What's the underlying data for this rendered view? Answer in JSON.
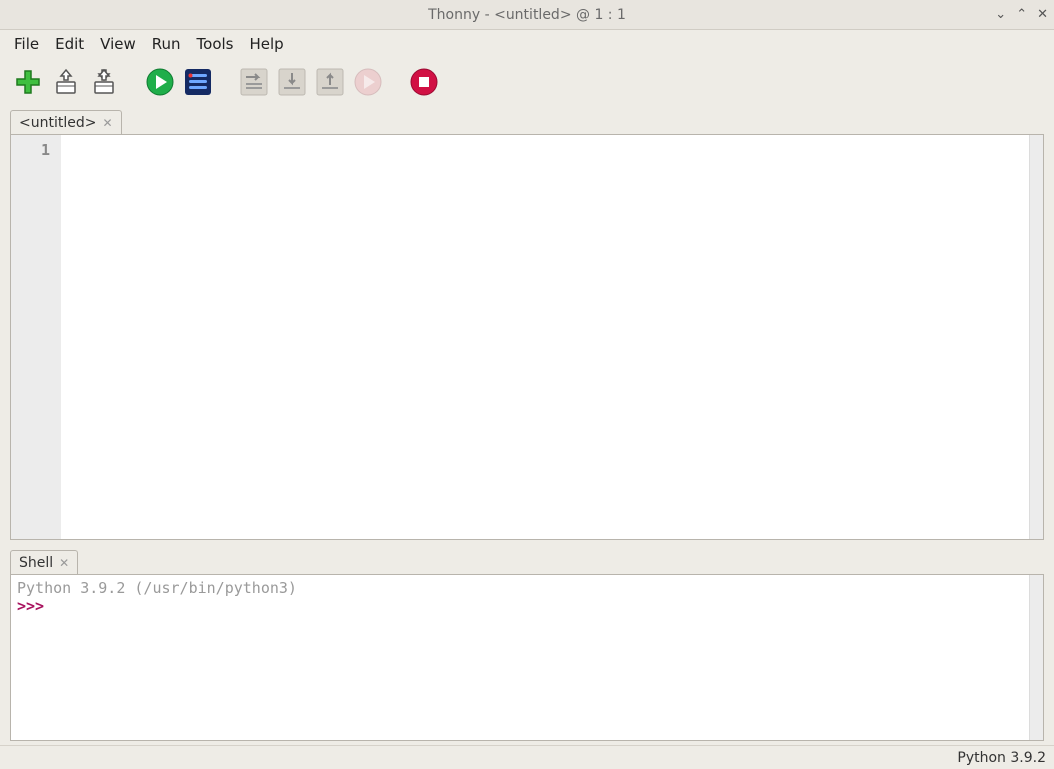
{
  "title": "Thonny  -  <untitled>  @  1 : 1",
  "window_controls": {
    "roll": "⌄",
    "max": "⌃",
    "close": "✕"
  },
  "menu": {
    "items": [
      "File",
      "Edit",
      "View",
      "Run",
      "Tools",
      "Help"
    ]
  },
  "toolbar": {
    "new": "new-file",
    "open": "open-file",
    "save": "save-file",
    "run": "run",
    "debug": "debug",
    "step_over": "step-over",
    "step_into": "step-into",
    "step_out": "step-out",
    "resume": "resume",
    "stop": "stop"
  },
  "editor": {
    "tab_label": "<untitled>",
    "line_numbers": [
      "1"
    ],
    "content": ""
  },
  "shell": {
    "tab_label": "Shell",
    "info_line": "Python 3.9.2 (/usr/bin/python3)",
    "prompt": ">>> "
  },
  "status": {
    "interpreter": "Python 3.9.2"
  }
}
